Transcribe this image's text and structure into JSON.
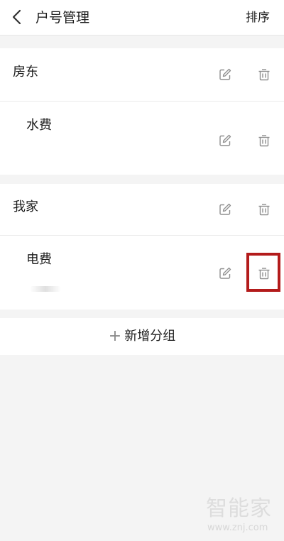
{
  "header": {
    "back_icon": "chevron-left-icon",
    "title": "户号管理",
    "action_label": "排序"
  },
  "groups": [
    {
      "name": "房东",
      "edit_icon": "edit-icon",
      "delete_icon": "trash-icon",
      "items": [
        {
          "name": "水费",
          "edit_icon": "edit-icon",
          "delete_icon": "trash-icon"
        }
      ]
    },
    {
      "name": "我家",
      "edit_icon": "edit-icon",
      "delete_icon": "trash-icon",
      "items": [
        {
          "name": "电费",
          "edit_icon": "edit-icon",
          "delete_icon": "trash-icon"
        }
      ]
    }
  ],
  "add_group": {
    "icon": "plus-icon",
    "label": "新增分组"
  },
  "annotation": {
    "highlight_color": "#b31b1b"
  },
  "watermark": {
    "logo": "智能家",
    "url": "www.znj.com"
  },
  "colors": {
    "background": "#f4f4f4",
    "card": "#ffffff",
    "icon": "#8f8f8f",
    "text": "#1d1d1d"
  }
}
